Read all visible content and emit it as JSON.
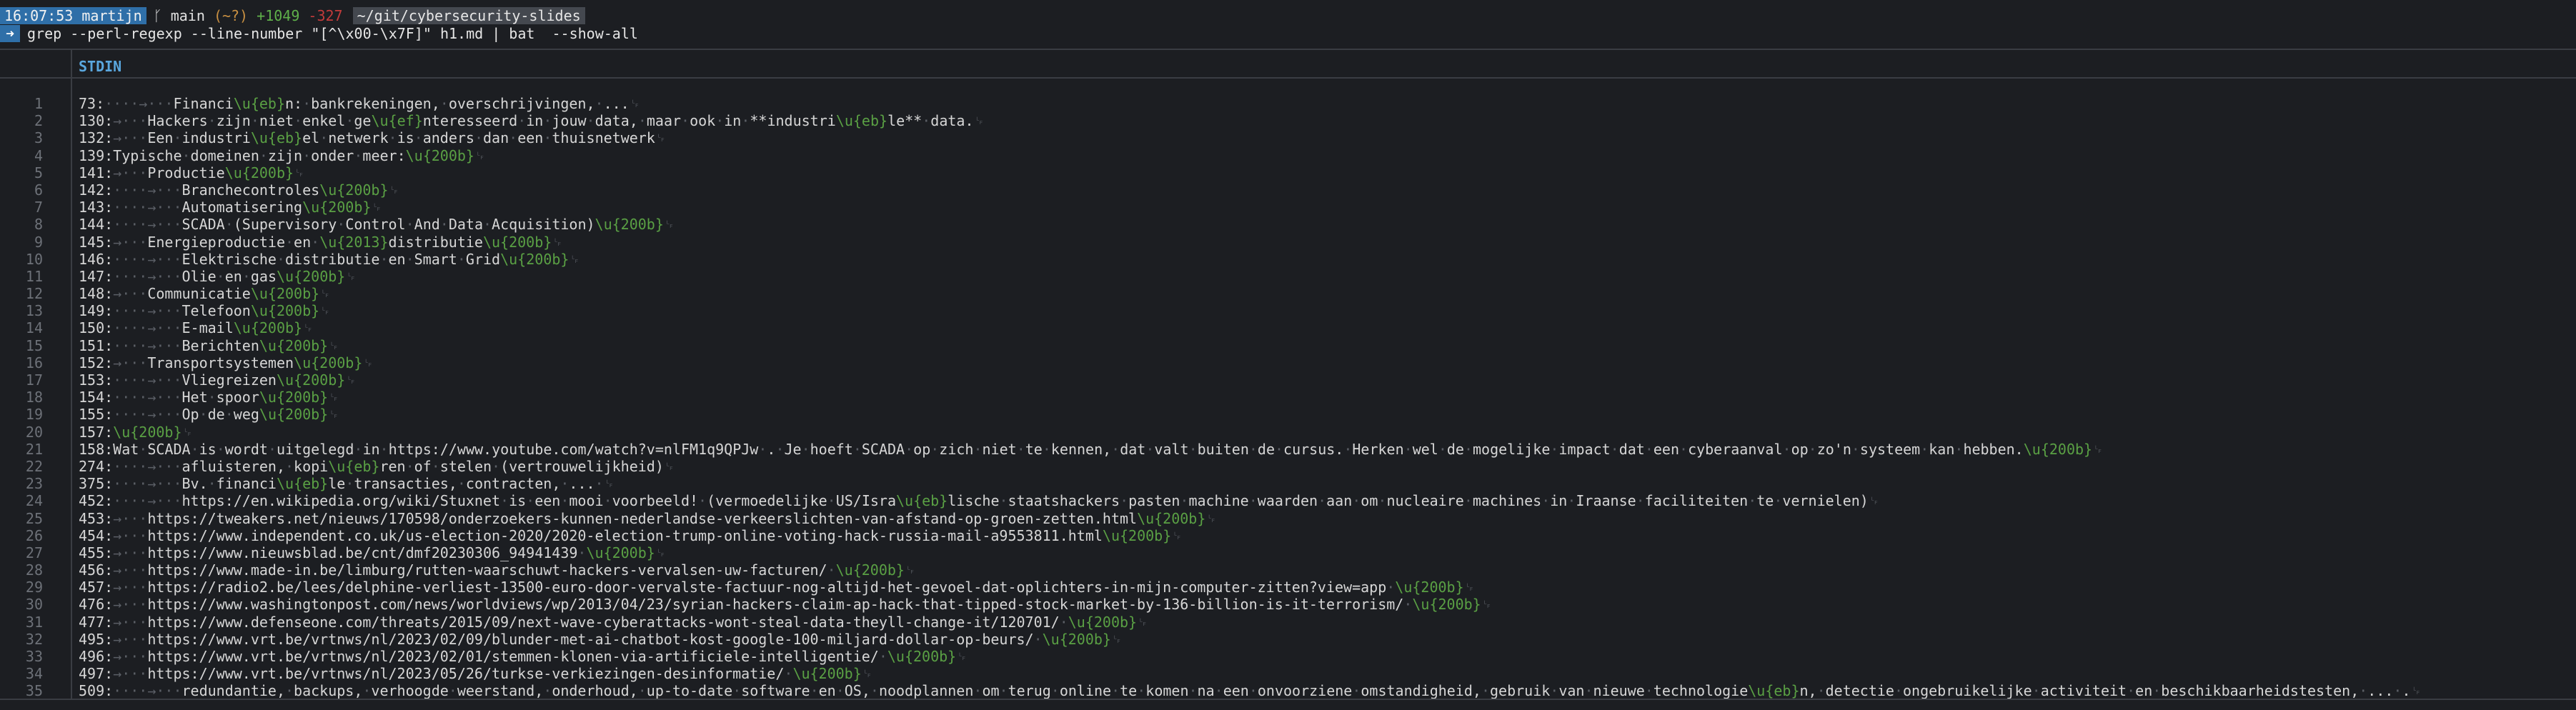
{
  "prompt": {
    "time": "16:07:53",
    "user": "martijn",
    "branch_icon": "git-branch-icon",
    "branch": "main",
    "unknown": "(~?)",
    "added": "+1049",
    "deleted": "-327",
    "path": "~/git/cybersecurity-slides"
  },
  "command": {
    "arrow": "➜",
    "text": "grep --perl-regexp --line-number \"[^\\x00-\\x7F]\" h1.md | bat  --show-all"
  },
  "bat": {
    "header": "STDIN",
    "lines": [
      "73:····→···Financi\\u{eb}n:·bankrekeningen,·overschrijvingen,·...␊",
      "130:→···Hackers·zijn·niet·enkel·ge\\u{ef}nteresseerd·in·jouw·data,·maar·ook·in·**industri\\u{eb}le**·data.␊",
      "132:→···Een·industri\\u{eb}el·netwerk·is·anders·dan·een·thuisnetwerk␊",
      "139:Typische·domeinen·zijn·onder·meer:\\u{200b}␊",
      "141:→···Productie\\u{200b}␊",
      "142:····→···Branchecontroles\\u{200b}␊",
      "143:····→···Automatisering\\u{200b}␊",
      "144:····→···SCADA·(Supervisory·Control·And·Data·Acquisition)\\u{200b}␊",
      "145:→···Energieproductie·en·\\u{2013}distributie\\u{200b}␊",
      "146:····→···Elektrische·distributie·en·Smart·Grid\\u{200b}␊",
      "147:····→···Olie·en·gas\\u{200b}␊",
      "148:→···Communicatie\\u{200b}␊",
      "149:····→···Telefoon\\u{200b}␊",
      "150:····→···E-mail\\u{200b}␊",
      "151:····→···Berichten\\u{200b}␊",
      "152:→···Transportsystemen\\u{200b}␊",
      "153:····→···Vliegreizen\\u{200b}␊",
      "154:····→···Het·spoor\\u{200b}␊",
      "155:····→···Op·de·weg\\u{200b}␊",
      "157:\\u{200b}␊",
      "158:Wat·SCADA·is·wordt·uitgelegd·in·https://www.youtube.com/watch?v=nlFM1q9QPJw·.·Je·hoeft·SCADA·op·zich·niet·te·kennen,·dat·valt·buiten·de·cursus.·Herken·wel·de·mogelijke·impact·dat·een·cyberaanval·op·zo'n·systeem·kan·hebben.\\u{200b}␊",
      "274:····→···afluisteren,·kopi\\u{eb}ren·of·stelen·(vertrouwelijkheid)␊",
      "375:····→···Bv.·financi\\u{eb}le·transacties,·contracten,·...·␊",
      "452:····→···https://en.wikipedia.org/wiki/Stuxnet·is·een·mooi·voorbeeld!·(vermoedelijke·US/Isra\\u{eb}lische·staatshackers·pasten·machine·waarden·aan·om·nucleaire·machines·in·Iraanse·faciliteiten·te·vernielen)␊",
      "453:→···https://tweakers.net/nieuws/170598/onderzoekers-kunnen-nederlandse-verkeerslichten-van-afstand-op-groen-zetten.html\\u{200b}␊",
      "454:→···https://www.independent.co.uk/us-election-2020/2020-election-trump-online-voting-hack-russia-mail-a9553811.html\\u{200b}␊",
      "455:→···https://www.nieuwsblad.be/cnt/dmf20230306_94941439·\\u{200b}␊",
      "456:→···https://www.made-in.be/limburg/rutten-waarschuwt-hackers-vervalsen-uw-facturen/·\\u{200b}␊",
      "457:→···https://radio2.be/lees/delphine-verliest-13500-euro-door-vervalste-factuur-nog-altijd-het-gevoel-dat-oplichters-in-mijn-computer-zitten?view=app·\\u{200b}␊",
      "476:→···https://www.washingtonpost.com/news/worldviews/wp/2013/04/23/syrian-hackers-claim-ap-hack-that-tipped-stock-market-by-136-billion-is-it-terrorism/·\\u{200b}␊",
      "477:→···https://www.defenseone.com/threats/2015/09/next-wave-cyberattacks-wont-steal-data-theyll-change-it/120701/·\\u{200b}␊",
      "495:→···https://www.vrt.be/vrtnws/nl/2023/02/09/blunder-met-ai-chatbot-kost-google-100-miljard-dollar-op-beurs/·\\u{200b}␊",
      "496:→···https://www.vrt.be/vrtnws/nl/2023/02/01/stemmen-klonen-via-artificiele-intelligentie/·\\u{200b}␊",
      "497:→···https://www.vrt.be/vrtnws/nl/2023/05/26/turkse-verkiezingen-desinformatie/·\\u{200b}␊",
      "509:····→···redundantie,·backups,·verhoogde·weerstand,·onderhoud,·up-to-date·software·en·OS,·noodplannen·om·terug·online·te·komen·na·een·onvoorziene·omstandigheid,·gebruik·van·nieuwe·technologie\\u{eb}n,·detectie·ongebruikelijke·activiteit·en·beschikbaarheidstesten,·...·.␊"
    ]
  },
  "colors": {
    "background": "#1c1e22",
    "accent": "#2f6fa8",
    "escape": "#5aa044",
    "header": "#5aa7de"
  }
}
